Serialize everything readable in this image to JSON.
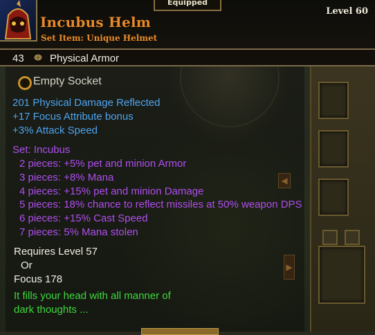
{
  "header": {
    "equipped_label": "Equipped",
    "item_name": "Incubus Helm",
    "item_type": "Set Item: Unique Helmet",
    "level": "Level 60"
  },
  "armor": {
    "value": "43",
    "label": "Physical Armor"
  },
  "socket": {
    "label": "Empty Socket"
  },
  "stats": [
    "201 Physical Damage Reflected",
    "+17 Focus Attribute bonus",
    "+3% Attack Speed"
  ],
  "set": {
    "title": "Set: Incubus",
    "bonuses": [
      "2 pieces: +5% pet and minion Armor",
      "3 pieces: +8% Mana",
      "4 pieces: +15% pet and minion Damage",
      "5 pieces: 18% chance to reflect missiles at 50% weapon DPS",
      "6 pieces: +15% Cast Speed",
      "7 pieces: 5% Mana stolen"
    ]
  },
  "requirements": {
    "level": "Requires Level 57",
    "or": "Or",
    "focus": "Focus 178"
  },
  "flavor": {
    "line1": "It fills your head with all manner of",
    "line2": "dark thoughts ..."
  },
  "colors": {
    "item_name": "#e88a28",
    "stat_blue": "#4ea4f0",
    "set_purple": "#b04ef0",
    "flavor_green": "#3ed83e"
  }
}
